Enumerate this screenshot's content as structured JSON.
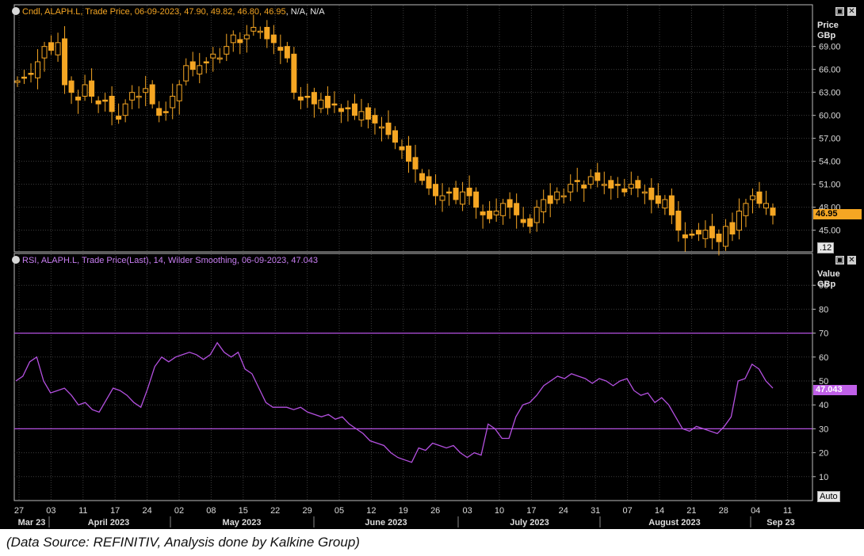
{
  "price_panel": {
    "header_series": "Cndl, ALAPH.L, Trade Price, 06-09-2023, 47.90, 49.82, 46.80, 46.95",
    "header_tail": ", N/A, N/A",
    "axis_title_1": "Price",
    "axis_title_2": "GBp",
    "last_value_tag": "46.95",
    "corner_box": ".12",
    "color": "#f5a623"
  },
  "rsi_panel": {
    "header": "RSI, ALAPH.L, Trade Price(Last),  14, Wilder Smoothing, 06-09-2023, 47.043",
    "axis_title_1": "Value",
    "axis_title_2": "GBp",
    "last_value_tag": "47.043",
    "color": "#b450e0"
  },
  "x_axis": {
    "day_ticks": [
      "27",
      "03",
      "11",
      "17",
      "24",
      "02",
      "08",
      "15",
      "22",
      "29",
      "05",
      "12",
      "19",
      "26",
      "03",
      "10",
      "17",
      "24",
      "31",
      "07",
      "14",
      "21",
      "28",
      "04",
      "11"
    ],
    "month_labels": [
      "Mar 23",
      "April 2023",
      "May 2023",
      "June 2023",
      "July 2023",
      "August 2023",
      "Sep 23"
    ],
    "auto_button": "Auto"
  },
  "source_note": "(Data Source: REFINITIV, Analysis done by Kalkine Group)",
  "chart_data": [
    {
      "type": "candlestick",
      "title": "Cndl, ALAPH.L, Trade Price, 06-09-2023, 47.90, 49.82, 46.80, 46.95, N/A, N/A",
      "ylabel": "Price GBp",
      "yticks": [
        45,
        48,
        51,
        54,
        57,
        60,
        63,
        66,
        69
      ],
      "ylim": [
        43,
        73
      ],
      "grid": true,
      "last_close": 46.95,
      "close": [
        64.5,
        65.0,
        65.5,
        67.0,
        69.0,
        68.5,
        69.5,
        64.0,
        63.0,
        62.0,
        64.0,
        62.5,
        61.5,
        62.0,
        60.5,
        59.5,
        61.5,
        63.0,
        62.5,
        63.5,
        61.5,
        60.0,
        60.5,
        62.5,
        64.0,
        66.5,
        66.0,
        66.5,
        67.0,
        68.0,
        67.5,
        69.0,
        70.5,
        69.5,
        70.5,
        71.5,
        71.0,
        70.0,
        69.5,
        68.5,
        67.5,
        63.0,
        62.0,
        62.5,
        61.5,
        62.0,
        61.0,
        61.5,
        60.5,
        61.0,
        60.0,
        60.5,
        59.5,
        59.0,
        58.5,
        57.5,
        56.5,
        55.5,
        54.0,
        53.0,
        51.5,
        50.5,
        49.5,
        49.5,
        50.0,
        49.0,
        50.0,
        49.5,
        48.0,
        47.0,
        46.5,
        47.5,
        48.5,
        48.0,
        47.0,
        46.0,
        45.5,
        48.0,
        49.0,
        48.5,
        50.0,
        49.5,
        51.0,
        51.5,
        50.5,
        52.0,
        51.5,
        51.0,
        50.5,
        51.0,
        50.0,
        51.0,
        50.5,
        50.0,
        49.0,
        48.5,
        49.0,
        47.0,
        45.0,
        44.0,
        44.5,
        44.5,
        45.0,
        44.0,
        43.5,
        45.5,
        44.5,
        47.5,
        48.5,
        49.5,
        48.5,
        48.5,
        46.95
      ],
      "open_vs_close": "mixed"
    },
    {
      "type": "line",
      "title": "RSI, ALAPH.L, Trade Price(Last),  14, Wilder Smoothing, 06-09-2023, 47.043",
      "ylabel": "Value GBp",
      "yticks": [
        10,
        20,
        30,
        40,
        50,
        60,
        70,
        80,
        90
      ],
      "ylim": [
        0,
        100
      ],
      "reference_lines": [
        70,
        30
      ],
      "last_value": 47.043,
      "values": [
        50,
        52,
        58,
        60,
        50,
        45,
        46,
        47,
        44,
        40,
        41,
        38,
        37,
        42,
        47,
        46,
        44,
        41,
        39,
        47,
        56,
        60,
        58,
        60,
        61,
        62,
        61,
        59,
        61,
        66,
        62,
        60,
        62,
        55,
        53,
        47,
        41,
        39,
        39,
        39,
        38,
        39,
        37,
        36,
        35,
        36,
        34,
        35,
        32,
        30,
        28,
        25,
        24,
        23,
        20,
        18,
        17,
        16,
        22,
        21,
        24,
        23,
        22,
        23,
        20,
        18,
        20,
        19,
        32,
        30,
        26,
        26,
        35,
        40,
        41,
        44,
        48,
        50,
        52,
        51,
        53,
        52,
        51,
        49,
        51,
        50,
        48,
        50,
        51,
        46,
        44,
        45,
        41,
        43,
        40,
        35,
        30,
        29,
        31,
        30,
        29,
        28,
        31,
        35,
        50,
        51,
        57,
        55,
        50,
        47
      ]
    }
  ]
}
